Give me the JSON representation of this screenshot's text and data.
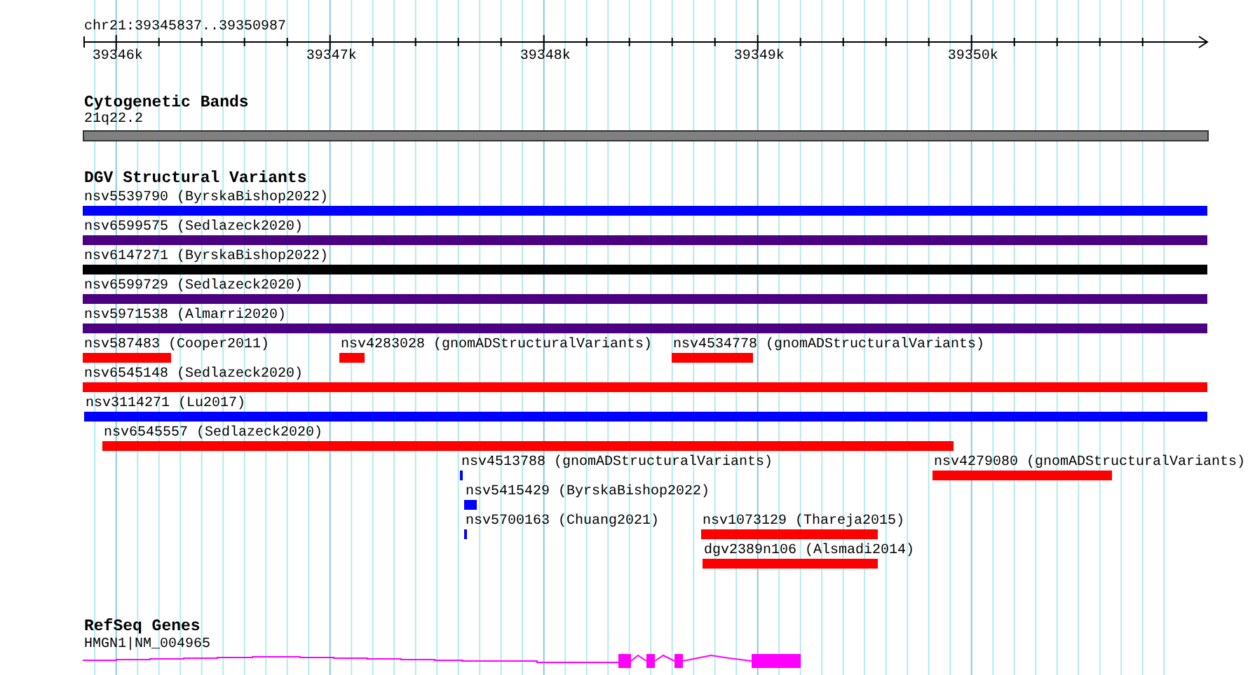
{
  "ruler": {
    "location": "chr21:39345837..39350987",
    "ticks": [
      "39346k",
      "39347k",
      "39348k",
      "39349k",
      "39350k"
    ]
  },
  "tracks": [
    {
      "kind": "bands",
      "title": "Cytogenetic Bands",
      "features": [
        {
          "label": "21q22.2",
          "color": "#808080"
        }
      ]
    },
    {
      "kind": "variants",
      "title": "DGV Structural Variants",
      "features": [
        {
          "label": "nsv5539790 (ByrskaBishop2022)",
          "color": "#0000ff"
        },
        {
          "label": "nsv6599575 (Sedlazeck2020)",
          "color": "#4b0082"
        },
        {
          "label": "nsv6147271 (ByrskaBishop2022)",
          "color": "#000000"
        },
        {
          "label": "nsv6599729 (Sedlazeck2020)",
          "color": "#4b0082"
        },
        {
          "label": "nsv5971538 (Almarri2020)",
          "color": "#4b0082"
        },
        {
          "label": "nsv587483 (Cooper2011)",
          "color": "#ff0000"
        },
        {
          "label": "nsv4283028 (gnomADStructuralVariants)",
          "color": "#ff0000"
        },
        {
          "label": "nsv4534778 (gnomADStructuralVariants)",
          "color": "#ff0000"
        },
        {
          "label": "nsv6545148 (Sedlazeck2020)",
          "color": "#ff0000"
        },
        {
          "label": "nsv3114271 (Lu2017)",
          "color": "#0000ff"
        },
        {
          "label": "nsv6545557 (Sedlazeck2020)",
          "color": "#ff0000"
        },
        {
          "label": "nsv4513788 (gnomADStructuralVariants)",
          "color": "#0000ff"
        },
        {
          "label": "nsv4279080 (gnomADStructuralVariants)",
          "color": "#ff0000"
        },
        {
          "label": "nsv5415429 (ByrskaBishop2022)",
          "color": "#0000ff"
        },
        {
          "label": "nsv5700163 (Chuang2021)",
          "color": "#0000ff"
        },
        {
          "label": "nsv1073129 (Thareja2015)",
          "color": "#ff0000"
        },
        {
          "label": "dgv2389n106 (Alsmadi2014)",
          "color": "#ff0000"
        }
      ]
    },
    {
      "kind": "genes",
      "title": "RefSeq Genes",
      "features": [
        {
          "label": "HMGN1|NM_004965",
          "color": "#ff00ff"
        }
      ]
    }
  ]
}
